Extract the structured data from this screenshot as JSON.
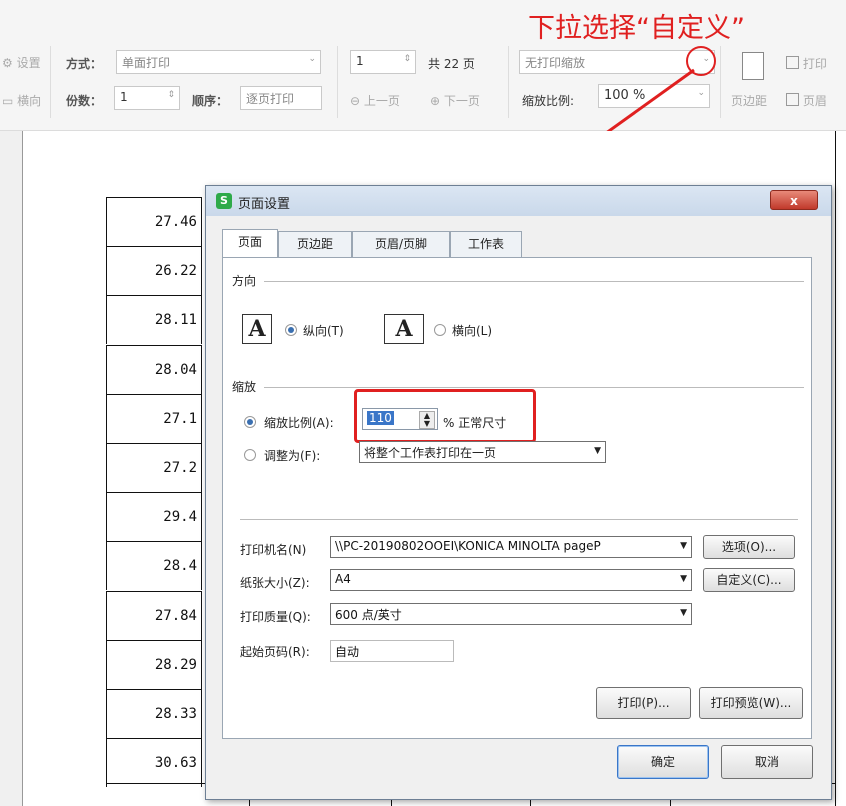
{
  "annotation": {
    "text": "下拉选择“自定义”",
    "color": "#e02020"
  },
  "toolbar": {
    "row1": {
      "settings_label": "设置",
      "mode_label": "方式：",
      "mode_value": "单面打印",
      "page_value": "1",
      "total_pages": "共 22 页",
      "scale_value": "无打印缩放",
      "print_label": "打印"
    },
    "row2": {
      "orientation_label": "横向",
      "copies_label": "份数：",
      "copies_value": "1",
      "order_label": "顺序：",
      "order_value": "逐页打印",
      "prev_page": "上一页",
      "next_page": "下一页",
      "zoom_label": "缩放比例:",
      "zoom_value": "100 %",
      "margin_label": "页边距",
      "header_label": "页眉"
    }
  },
  "sheet": {
    "values": [
      "27.46",
      "26.22",
      "28.11",
      "28.04",
      "27.1",
      "27.2",
      "29.4",
      "28.4",
      "27.84",
      "28.29",
      "28.33",
      "30.63"
    ]
  },
  "dialog": {
    "title": "页面设置",
    "close_label": "x",
    "tabs": [
      "页面",
      "页边距",
      "页眉/页脚",
      "工作表"
    ],
    "orientation": {
      "section": "方向",
      "portrait": "纵向(T)",
      "landscape": "横向(L)",
      "icon_letter": "A"
    },
    "scaling": {
      "section": "缩放",
      "ratio_label": "缩放比例(A):",
      "ratio_value": "110",
      "ratio_suffix": "% 正常尺寸",
      "fit_label": "调整为(F):",
      "fit_value": "将整个工作表打印在一页"
    },
    "printer": {
      "name_label": "打印机名(N)",
      "name_value": "\\\\PC-20190802OOEI\\KONICA MINOLTA pageP",
      "options_button": "选项(O)...",
      "paper_label": "纸张大小(Z):",
      "paper_value": "A4",
      "custom_button": "自定义(C)...",
      "quality_label": "打印质量(Q):",
      "quality_value": "600 点/英寸",
      "start_label": "起始页码(R):",
      "start_value": "自动"
    },
    "print_button": "打印(P)...",
    "preview_button": "打印预览(W)...",
    "ok_button": "确定",
    "cancel_button": "取消"
  }
}
